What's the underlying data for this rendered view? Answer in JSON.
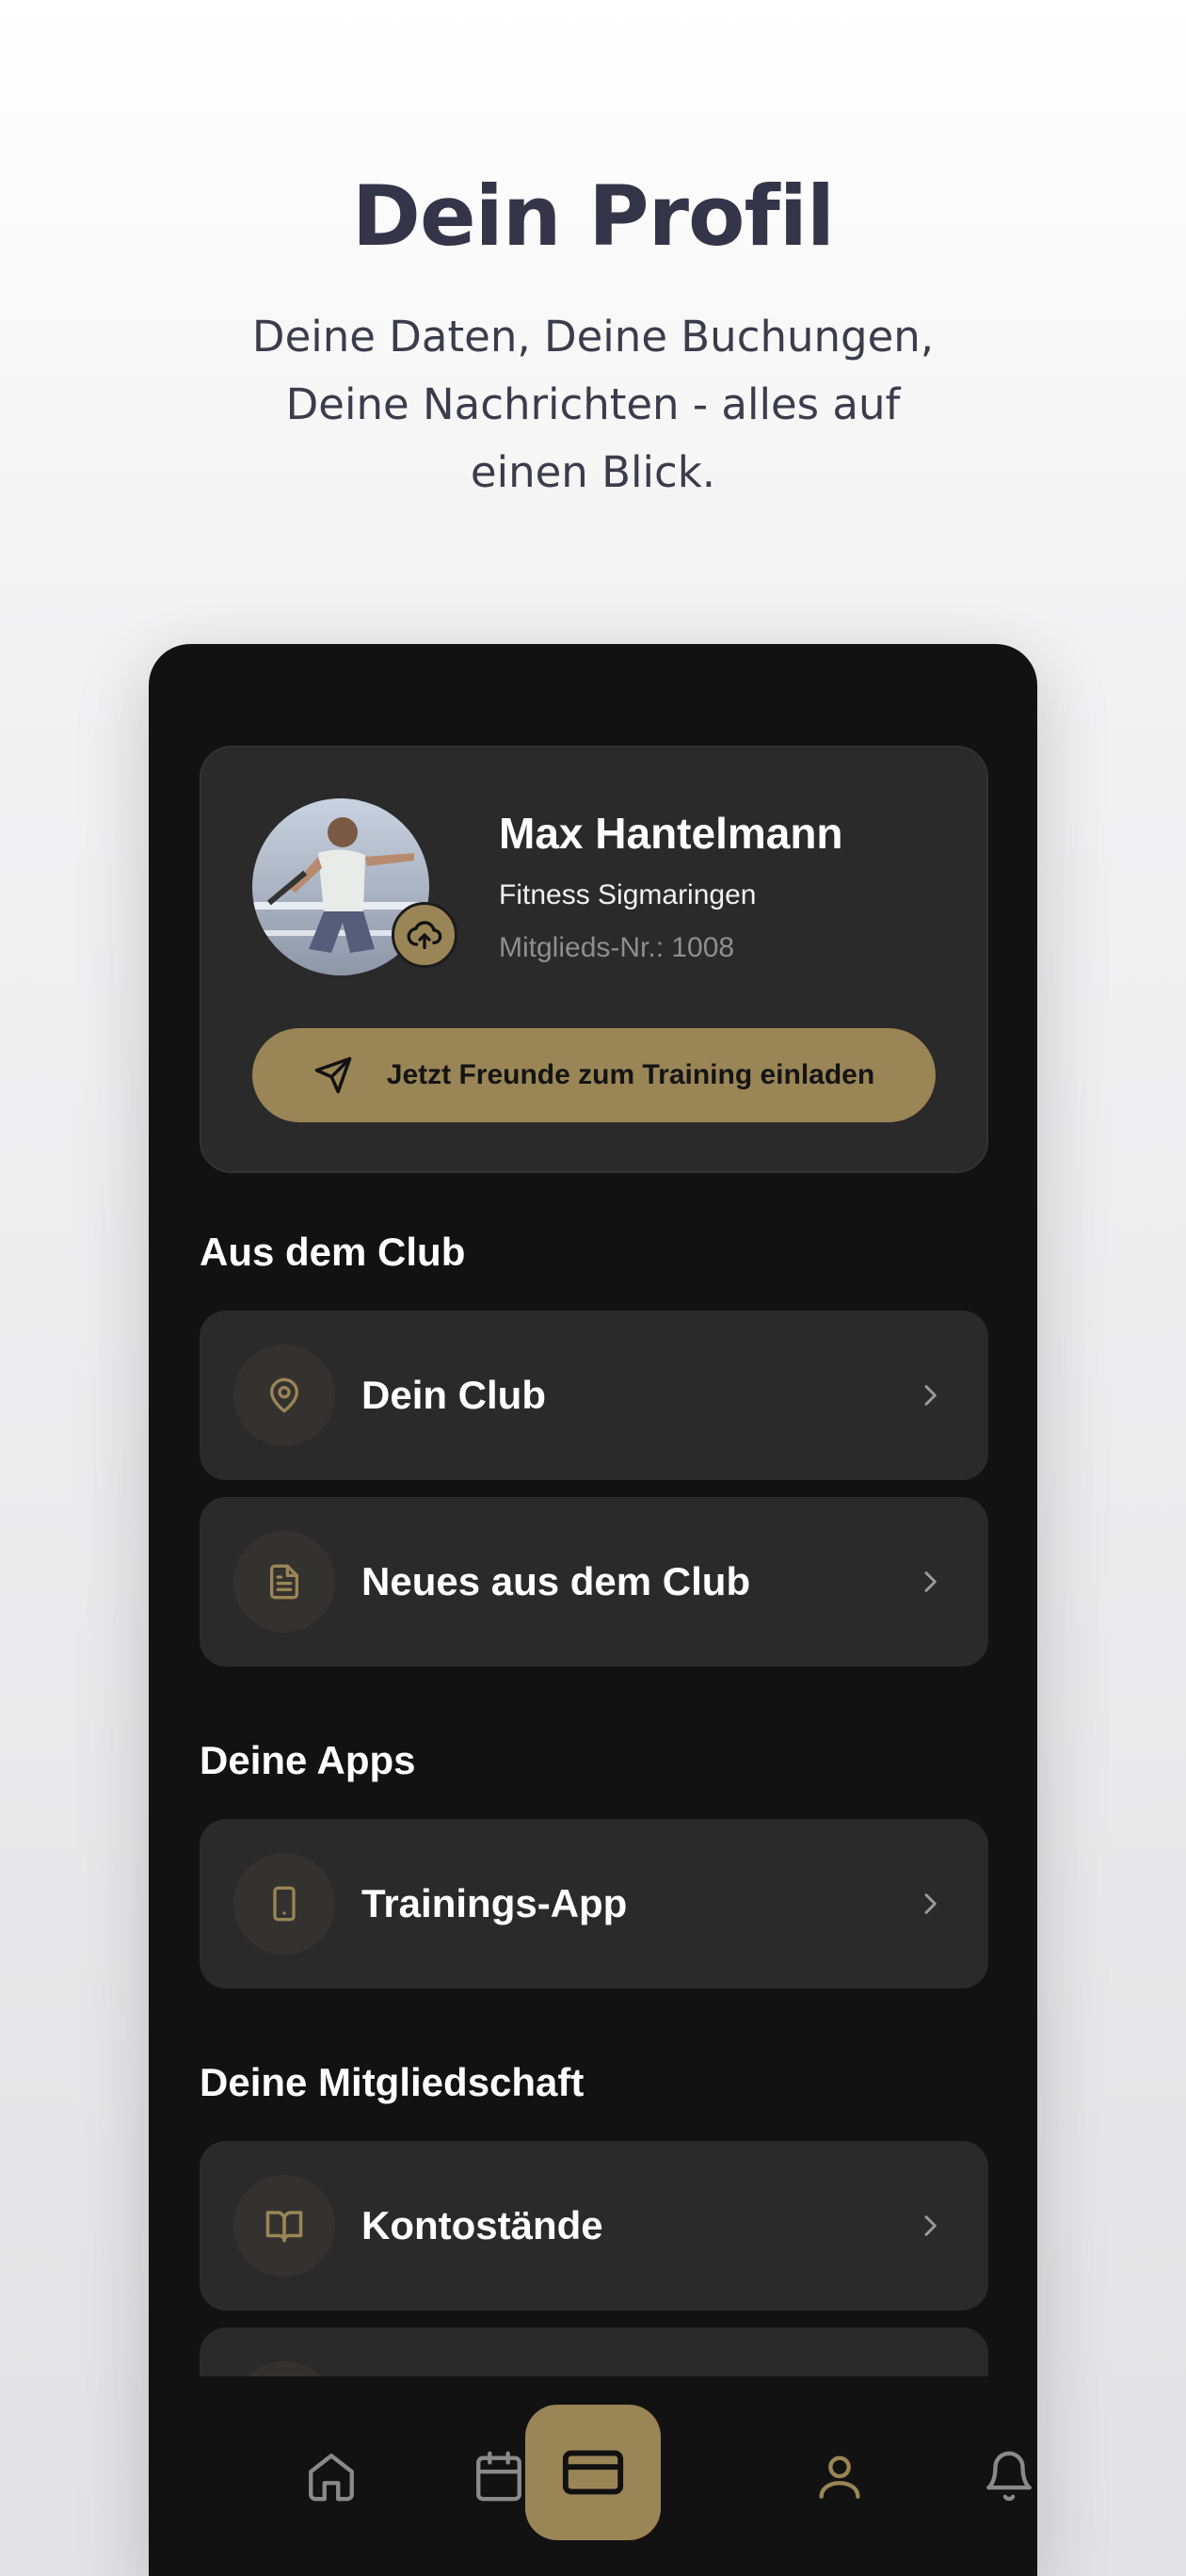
{
  "header": {
    "title": "Dein Profil",
    "subtitle_lines": [
      "Deine Daten, Deine Buchungen,",
      "Deine Nachrichten - alles auf",
      "einen Blick."
    ]
  },
  "profile": {
    "name": "Max Hantelmann",
    "club": "Fitness Sigmaringen",
    "member_number": "Mitglieds-Nr.: 1008",
    "invite_label": "Jetzt Freunde zum Training einladen",
    "avatar_icon": "person-photo",
    "upload_icon": "cloud-upload-icon"
  },
  "sections": [
    {
      "title": "Aus dem Club",
      "items": [
        {
          "label": "Dein Club",
          "icon": "map-pin-icon"
        },
        {
          "label": "Neues aus dem Club",
          "icon": "document-icon"
        }
      ]
    },
    {
      "title": "Deine Apps",
      "items": [
        {
          "label": "Trainings-App",
          "icon": "smartphone-icon"
        }
      ]
    },
    {
      "title": "Deine Mitgliedschaft",
      "items": [
        {
          "label": "Kontostände",
          "icon": "book-open-icon"
        }
      ]
    }
  ],
  "bottom_nav": {
    "items": [
      "home-icon",
      "calendar-icon",
      "card-icon",
      "user-icon",
      "bell-icon"
    ],
    "active": "user-icon"
  },
  "colors": {
    "accent": "#9a8556",
    "background_dark": "#121212",
    "card": "#2a2a2a",
    "headline": "#35354a"
  }
}
